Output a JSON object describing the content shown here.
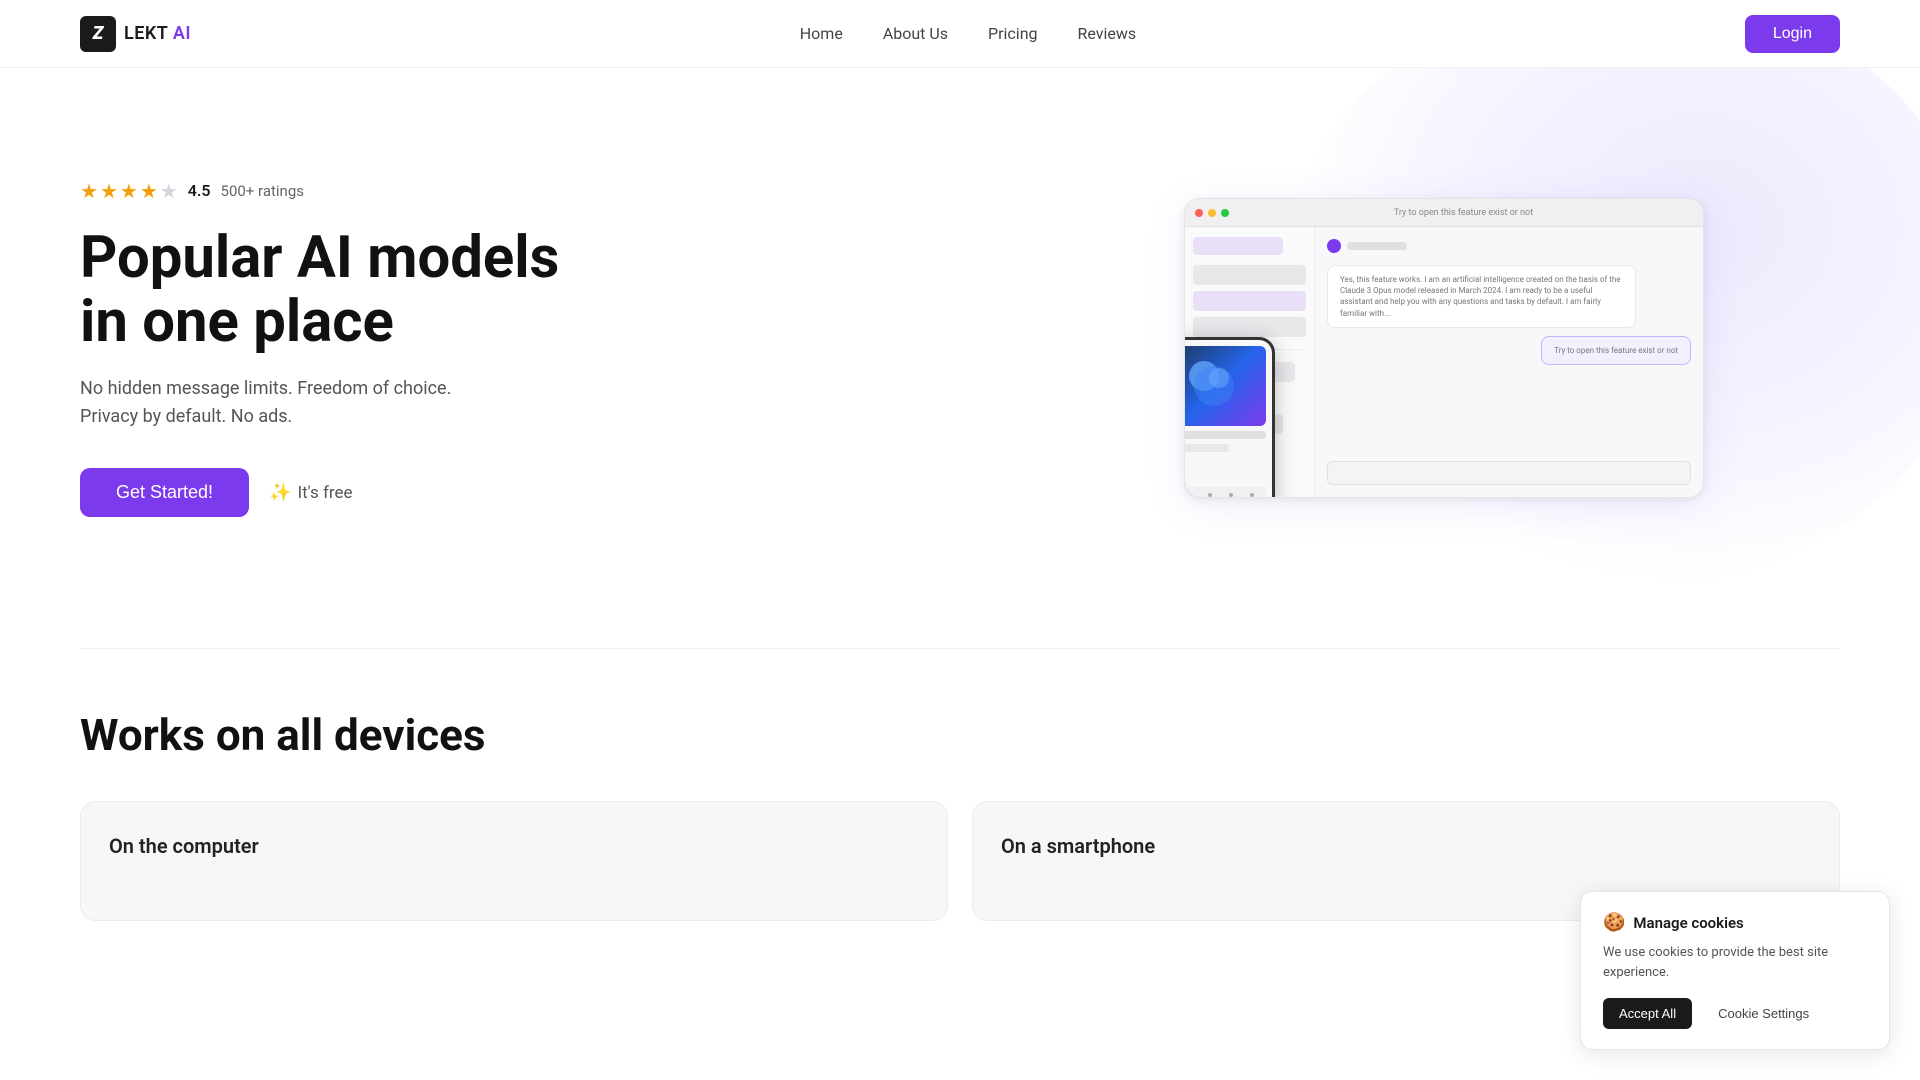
{
  "nav": {
    "logo_icon": "Z",
    "logo_name": "LEKT AI",
    "logo_brand": "AI",
    "links": [
      {
        "label": "Home",
        "id": "home"
      },
      {
        "label": "About Us",
        "id": "about"
      },
      {
        "label": "Pricing",
        "id": "pricing"
      },
      {
        "label": "Reviews",
        "id": "reviews"
      }
    ],
    "login_label": "Login"
  },
  "hero": {
    "rating_score": "4.5",
    "rating_count": "500+ ratings",
    "title_line1": "Popular AI models",
    "title_line2": "in one place",
    "subtitle": "No hidden message limits. Freedom of choice. Privacy by default. No ads.",
    "cta_button": "Get Started!",
    "free_label": "It's free"
  },
  "mockup": {
    "chat_text_1": "Yes, this feature works. I am an artificial intelligence created on the basis of the Claude 3 Opus model released in March 2024. I am ready to be a useful assistant and help you with any questions and tasks by default. I am fairly familiar with...",
    "chat_text_2": "Try to open this feature exist or not"
  },
  "devices_section": {
    "title": "Works on all devices",
    "cards": [
      {
        "title": "On the computer",
        "id": "computer"
      },
      {
        "title": "On a smartphone",
        "id": "smartphone"
      }
    ]
  },
  "cookie": {
    "emoji": "🍪",
    "title": "Manage cookies",
    "text": "We use cookies to provide the best site experience.",
    "accept_label": "Accept All",
    "settings_label": "Cookie Settings"
  }
}
